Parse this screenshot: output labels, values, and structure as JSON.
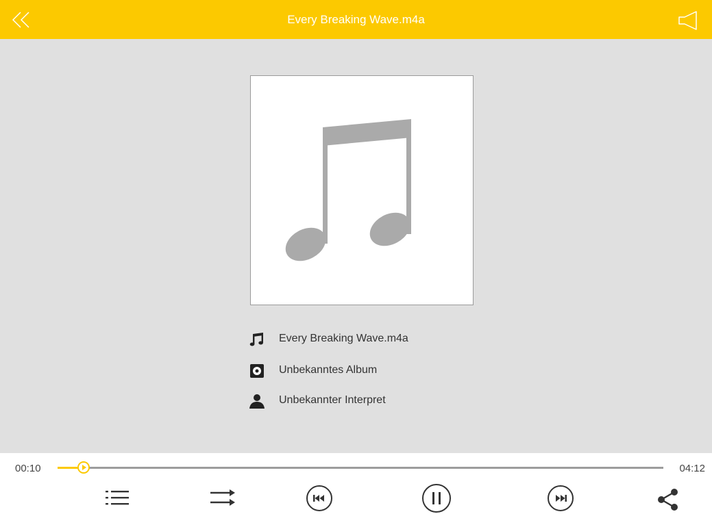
{
  "header": {
    "title": "Every Breaking Wave.m4a",
    "background_color": "#fcc900",
    "back_icon": "double-chevron-left-icon",
    "volume_icon": "speaker-icon"
  },
  "album_art": {
    "placeholder_icon": "music-note-icon"
  },
  "track_info": {
    "title": "Every Breaking Wave.m4a",
    "album": "Unbekanntes Album",
    "artist": "Unbekannter Interpret"
  },
  "player": {
    "current_time": "00:10",
    "total_time": "04:12",
    "progress_fraction": 0.04,
    "accent_color": "#fcc900",
    "controls": [
      "playlist-icon",
      "repeat-icon",
      "previous-icon",
      "pause-icon",
      "next-icon",
      "share-icon"
    ]
  }
}
